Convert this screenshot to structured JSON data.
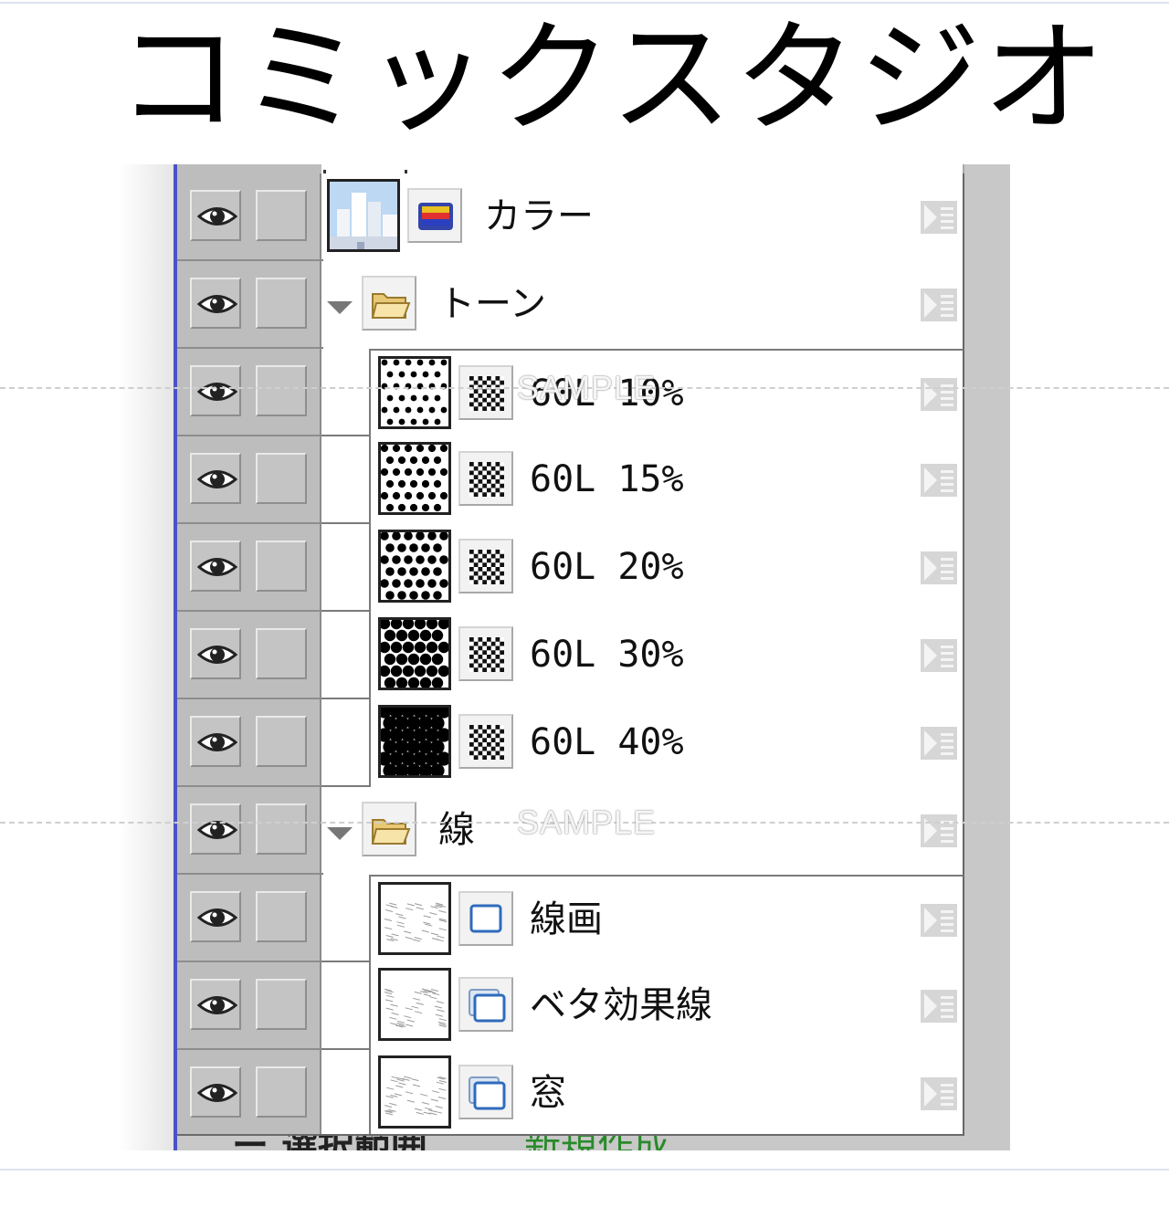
{
  "page_title": "コミックスタジオ",
  "watermark": "SAMPLE",
  "colors": {
    "panel_border": "#4a52c8",
    "grey_column": "#bdbdbd",
    "partial_green": "#2a8a2a"
  },
  "layers": [
    {
      "name": "カラー",
      "kind": "color",
      "indent": false,
      "folder": false
    },
    {
      "name": "トーン",
      "kind": "folder",
      "indent": false,
      "folder": true
    },
    {
      "name": "60L 10%",
      "kind": "tone",
      "indent": true,
      "density": 0.1
    },
    {
      "name": "60L 15%",
      "kind": "tone",
      "indent": true,
      "density": 0.15
    },
    {
      "name": "60L 20%",
      "kind": "tone",
      "indent": true,
      "density": 0.2
    },
    {
      "name": "60L 30%",
      "kind": "tone",
      "indent": true,
      "density": 0.3
    },
    {
      "name": "60L 40%",
      "kind": "tone",
      "indent": true,
      "density": 0.4
    },
    {
      "name": "線",
      "kind": "folder",
      "indent": false,
      "folder": true
    },
    {
      "name": "線画",
      "kind": "raster",
      "indent": true
    },
    {
      "name": "ベタ効果線",
      "kind": "raster2",
      "indent": true
    },
    {
      "name": "窓",
      "kind": "raster2",
      "indent": true
    }
  ],
  "bottom_partial": {
    "left": "ー 選択範囲",
    "right": "新規作成"
  },
  "icons": {
    "visibility": "eye-icon",
    "lock": "lock-toggle",
    "folder": "folder-icon",
    "tone": "checker-icon",
    "raster": "raster-layer-icon",
    "color": "color-layer-icon",
    "properties": "layer-properties-icon",
    "expand": "triangle-down-icon"
  }
}
